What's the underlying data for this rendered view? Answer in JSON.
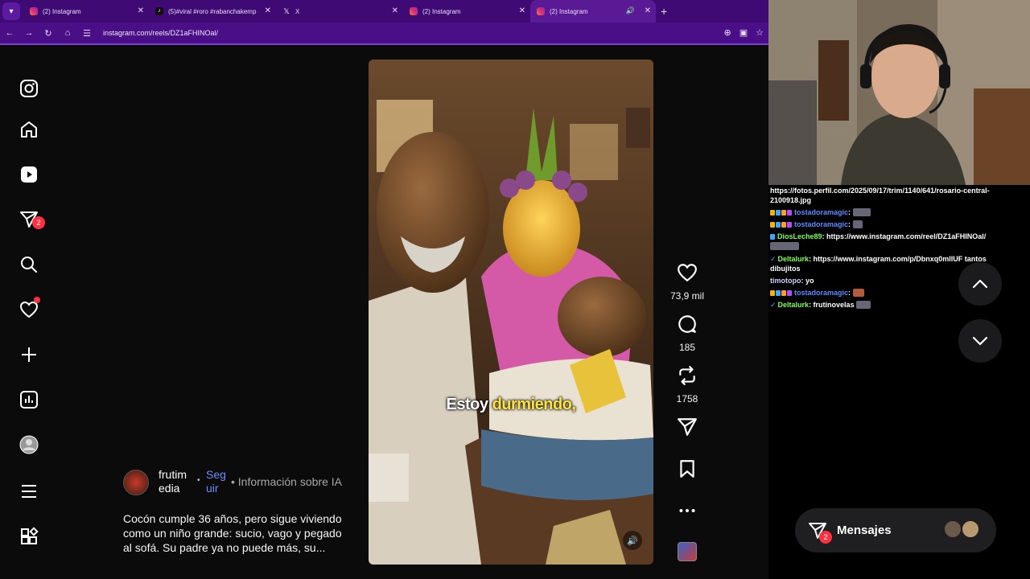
{
  "browser": {
    "tabs": [
      {
        "title": "(2) Instagram",
        "favicon": "instagram-icon",
        "active": false
      },
      {
        "title": "(5)#viral #roro #rabanchakemp",
        "favicon": "tiktok-icon",
        "active": false
      },
      {
        "title": "X",
        "favicon": "x-icon",
        "active": false
      },
      {
        "title": "(2) Instagram",
        "favicon": "instagram-icon",
        "active": false
      },
      {
        "title": "(2) Instagram",
        "favicon": "instagram-icon",
        "active": true,
        "audio": true
      }
    ],
    "url": "instagram.com/reels/DZ1aFHINOal/",
    "accent": "#4a0f86"
  },
  "sidebar": {
    "items": [
      {
        "icon": "instagram-logo-icon"
      },
      {
        "icon": "home-icon"
      },
      {
        "icon": "reels-icon"
      },
      {
        "icon": "direct-messages-icon",
        "badge": "2"
      },
      {
        "icon": "search-icon"
      },
      {
        "icon": "notifications-heart-icon",
        "dot": true
      },
      {
        "icon": "create-plus-icon"
      },
      {
        "icon": "dashboard-icon"
      },
      {
        "icon": "profile-avatar-icon"
      },
      {
        "icon": "menu-icon"
      },
      {
        "icon": "more-apps-icon"
      }
    ]
  },
  "reel": {
    "overlay_text_white": "Estoy",
    "overlay_text_yellow": "durmiendo,",
    "likes": "73,9 mil",
    "comments": "185",
    "reposts": "1758",
    "author": "frutimedia",
    "author_line1": "frutim",
    "author_line2": "edia",
    "follow_line1": "Seg",
    "follow_line2": "uir",
    "ai_info": "Información sobre IA",
    "description": "Cocón cumple 36 años, pero sigue viviendo como un niño grande: sucio, vago y pegado al sofá. Su padre ya no puede más, su..."
  },
  "chat": {
    "messages": [
      {
        "user": "",
        "text": "https://fotos.perfil.com/2025/09/17/trim/1140/641/rosario-central-2100918.jpg",
        "color": "#ffffff"
      },
      {
        "user": "tostadoramagic",
        "text": ":",
        "color": "#5b8cff",
        "emote": true
      },
      {
        "user": "tostadoramagic",
        "text": ":",
        "color": "#5b8cff",
        "emote": true
      },
      {
        "user": "DiosLeche89",
        "text": ": https://www.instagram.com/reel/DZ1aFHINOal/",
        "color": "#7cff4f"
      },
      {
        "user": "Deltalurk",
        "text": ": https://www.instagram.com/p/Dbnxq0mllUF tantos dibujitos",
        "color": "#7cff4f"
      },
      {
        "user": "timotopo",
        "text": ": yo",
        "color": "#cfcfff"
      },
      {
        "user": "tostadoramagic",
        "text": ":",
        "color": "#5b8cff",
        "emote": true
      },
      {
        "user": "Deltalurk",
        "text": ": frutinovelas",
        "color": "#7cff4f",
        "emote": true
      }
    ]
  },
  "messages_pill": {
    "label": "Mensajes",
    "badge": "2"
  }
}
